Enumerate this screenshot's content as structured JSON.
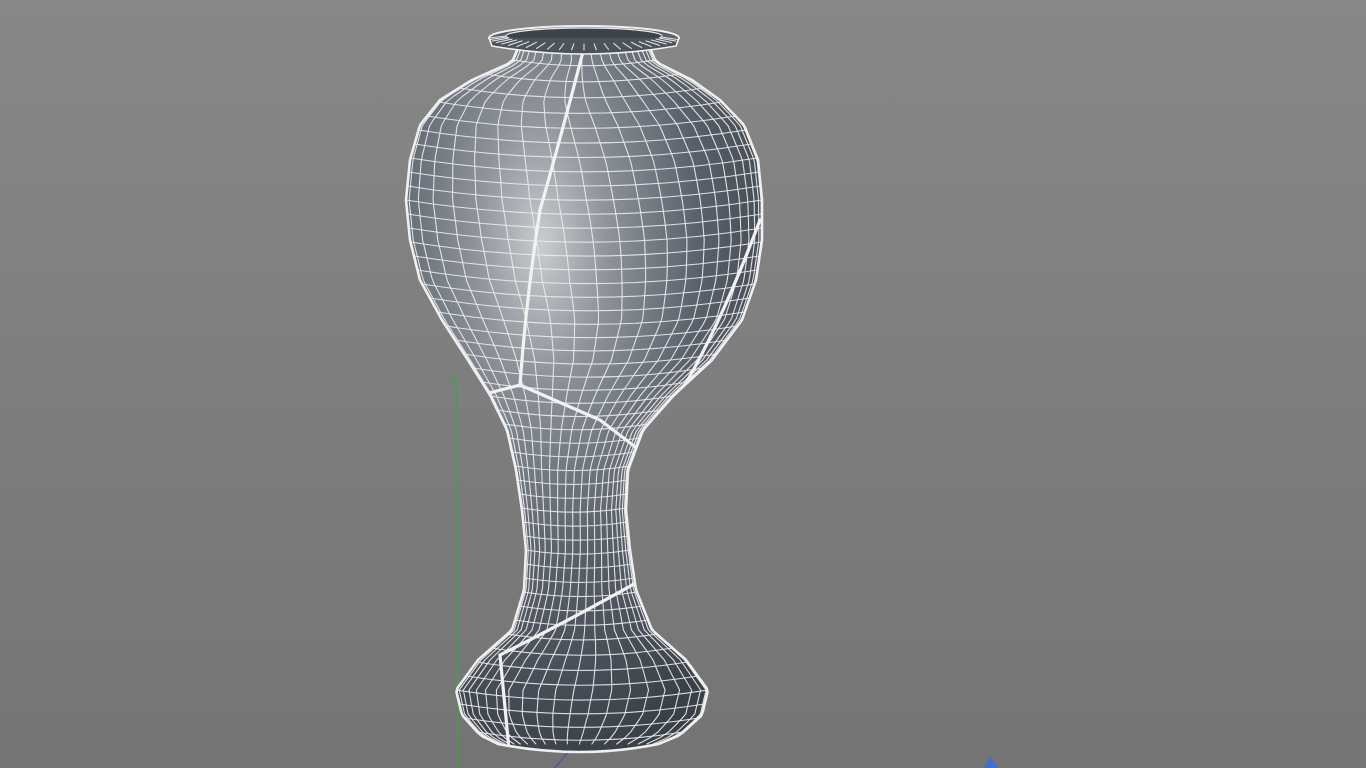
{
  "viewport": {
    "view": "perspective",
    "shading": "smooth-shaded-with-wireframe",
    "background_colors": [
      "#878787",
      "#747474"
    ],
    "object": {
      "name": "vase-mesh",
      "surface_color": "#4e5560",
      "highlight_color": "#c9ccd0",
      "wire_color": "#e8e8e8"
    },
    "axis_colors": {
      "y": "#3fa33f",
      "z": "#3e6fd6",
      "x": "#5a4fb0"
    }
  }
}
